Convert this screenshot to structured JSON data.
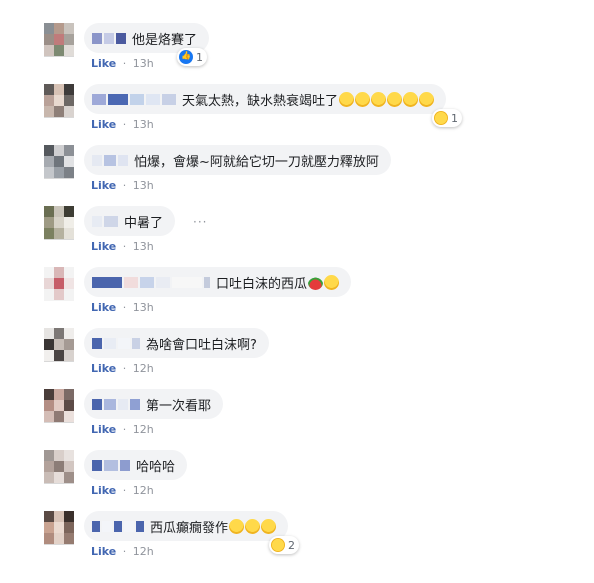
{
  "ui": {
    "like_label": "Like",
    "separator": "·",
    "more_dots": "···"
  },
  "comments": [
    {
      "text": "他是烙賽了",
      "time": "13h",
      "reaction_count": "1",
      "reaction_type": "like-icon"
    },
    {
      "text": "天氣太熱，缺水熱衰竭吐了",
      "emojis": [
        "crying-face-icon",
        "crying-face-icon",
        "crying-face-icon",
        "crying-face-icon",
        "crying-face-icon",
        "crying-face-icon"
      ],
      "time": "13h",
      "reaction_count": "1",
      "reaction_type": "haha-icon"
    },
    {
      "text": "怕爆，會爆~阿就給它切一刀就壓力釋放阿",
      "time": "13h"
    },
    {
      "text": "中暑了",
      "time": "13h"
    },
    {
      "text": "口吐白沫的西瓜",
      "emojis": [
        "watermelon-icon",
        "grinning-face-icon"
      ],
      "time": "13h"
    },
    {
      "text": "為啥會口吐白沫啊?",
      "time": "12h"
    },
    {
      "text": "第一次看耶",
      "time": "12h"
    },
    {
      "text": "哈哈哈",
      "time": "12h"
    },
    {
      "text": "西瓜癲癇發作",
      "emojis": [
        "laughing-face-icon",
        "laughing-face-icon",
        "laughing-face-icon"
      ],
      "time": "12h",
      "reaction_count": "2",
      "reaction_type": "haha-icon"
    }
  ],
  "colors": {
    "link": "#4267b2",
    "bubble": "#f2f3f5",
    "meta": "#90949c",
    "text": "#1c1e21"
  }
}
